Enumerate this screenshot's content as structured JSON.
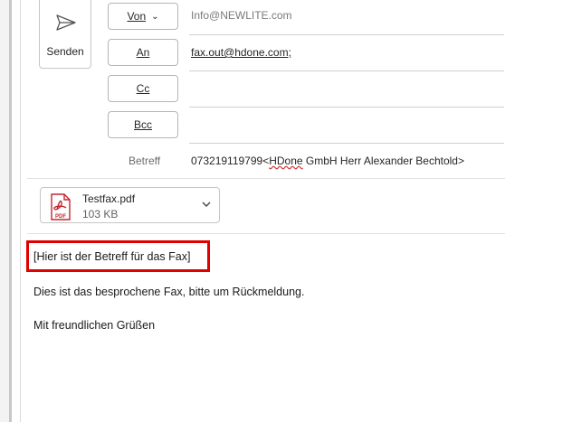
{
  "send_button": {
    "label": "Senden"
  },
  "fields": {
    "from": {
      "button_label": "Von",
      "value": "Info@NEWLITE.com"
    },
    "to": {
      "button_label": "An",
      "value": "fax.out@hdone.com;"
    },
    "cc": {
      "button_label": "Cc",
      "value": ""
    },
    "bcc": {
      "button_label": "Bcc",
      "value": ""
    },
    "subject": {
      "label": "Betreff",
      "value_prefix": "073219119799<",
      "value_flagged": "HDone",
      "value_suffix": " GmbH Herr Alexander Bechtold>"
    }
  },
  "attachment": {
    "name": "Testfax.pdf",
    "size": "103 KB",
    "icon_label": "PDF"
  },
  "body": {
    "line1": "[Hier ist der Betreff für das Fax]",
    "line2": "Dies ist das besprochene Fax, bitte um Rückmeldung.",
    "line3": "Mit freundlichen Grüßen"
  },
  "colors": {
    "highlight": "#e00000",
    "pdf_red": "#c4262e",
    "spell_error": "#d13438"
  }
}
